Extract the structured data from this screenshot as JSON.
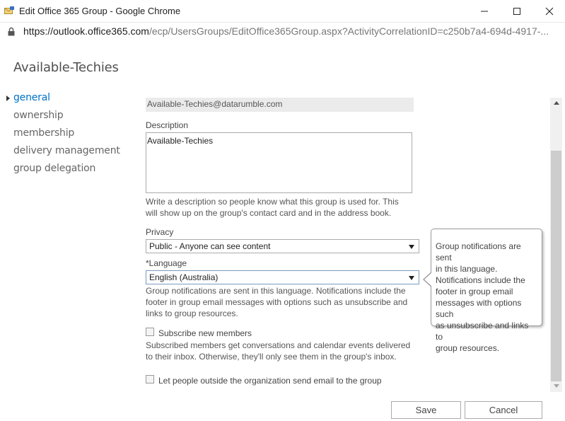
{
  "window": {
    "title": "Edit Office 365 Group - Google Chrome",
    "url_host": "https://outlook.office365.com",
    "url_path": "/ecp/UsersGroups/EditOffice365Group.aspx?ActivityCorrelationID=c250b7a4-694d-4917-..."
  },
  "page": {
    "title": "Available-Techies"
  },
  "nav": {
    "items": [
      {
        "label": "general"
      },
      {
        "label": "ownership"
      },
      {
        "label": "membership"
      },
      {
        "label": "delivery management"
      },
      {
        "label": "group delegation"
      }
    ]
  },
  "form": {
    "email_value": "Available-Techies@datarumble.com",
    "description_label": "Description",
    "description_value": "Available-Techies",
    "description_help_1": "Write a description so people know what this group is used for. This",
    "description_help_2": "will show up on the group's contact card and in the address book.",
    "privacy_label": "Privacy",
    "privacy_value": "Public - Anyone can see content",
    "language_label": "*Language",
    "language_value": "English (Australia)",
    "language_help_1": "Group notifications are sent in this language. Notifications include the",
    "language_help_2": "footer in group email messages with options such as unsubscribe and",
    "language_help_3": "links to group resources.",
    "subscribe_label": "Subscribe new members",
    "subscribe_help_1": "Subscribed members get conversations and calendar events delivered",
    "subscribe_help_2": "to their inbox. Otherwise, they'll only see them in the group's inbox.",
    "outside_label": "Let people outside the organization send email to the group"
  },
  "callout": {
    "lines": [
      "Group notifications are sent",
      "in this language.",
      "Notifications include the",
      "footer in group email",
      "messages with options such",
      "as unsubscribe and links to",
      "group resources."
    ]
  },
  "actions": {
    "save_label": "Save",
    "cancel_label": "Cancel"
  },
  "colors": {
    "accent": "#0072c6"
  }
}
